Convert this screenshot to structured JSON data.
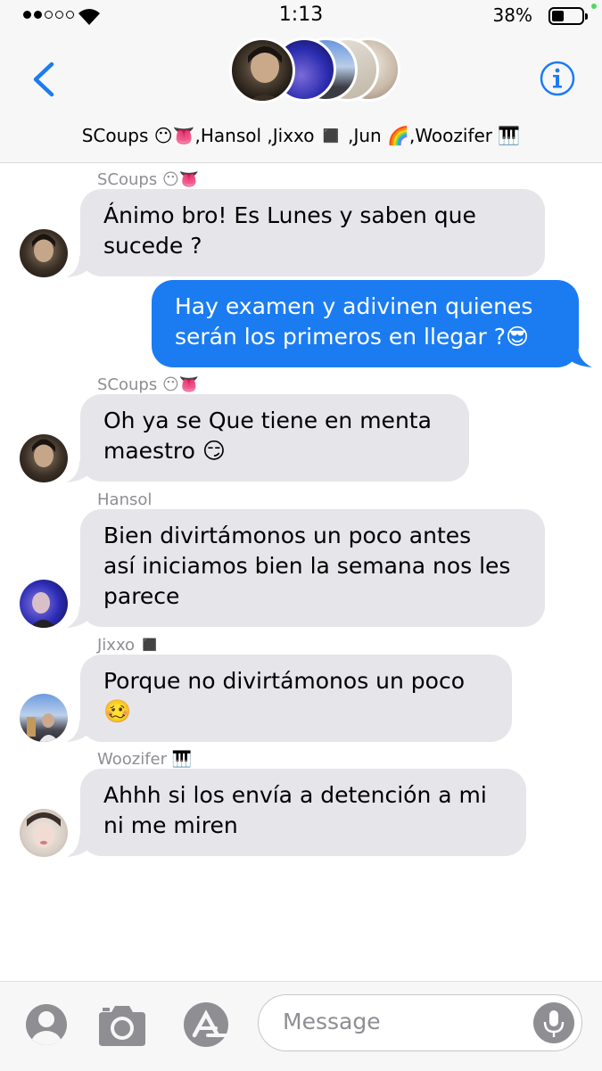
{
  "status_bar": {
    "time": "1:13",
    "battery_percent": "38%",
    "battery_level": 0.38,
    "signal_bars_filled": 2,
    "signal_bars_total": 5
  },
  "header": {
    "group_title": "SCoups 😶👅,Hansol ,Jixxo ◼️ ,Jun 🌈,Woozifer 🎹",
    "back_icon": "chevron-left-icon",
    "info_icon": "info-icon"
  },
  "messages": [
    {
      "sender": "SCoups 😶👅",
      "text": "Ánimo bro! Es Lunes y saben que sucede ?",
      "line1": "Ánimo bro! Es Lunes y saben que",
      "line2": "sucede ?",
      "direction": "incoming"
    },
    {
      "sender": "",
      "text": "Hay examen y adivinen quienes serán los primeros en llegar ?😎",
      "line1": "Hay examen y adivinen quienes",
      "line2": "serán los primeros en llegar ?😎",
      "direction": "outgoing"
    },
    {
      "sender": "SCoups 😶👅",
      "text": "Oh ya se Que tiene en menta maestro 😏",
      "line1": "Oh ya se Que tiene en menta",
      "line2": "maestro 😏",
      "direction": "incoming"
    },
    {
      "sender": "Hansol",
      "text": "Bien divirtámonos un poco antes así iniciamos bien la semana nos les parece",
      "line1": "Bien divirtámonos un poco antes",
      "line2": "así iniciamos bien la semana nos les",
      "line3": "parece",
      "direction": "incoming"
    },
    {
      "sender": "Jixxo ◼️",
      "text": "Porque no divirtámonos un poco 🥴",
      "line1": "Porque no divirtámonos un poco",
      "line2": "🥴",
      "direction": "incoming"
    },
    {
      "sender": "Woozifer 🎹",
      "text": "Ahhh si los envía a detención a mi ni me miren",
      "line1": "Ahhh si los envía a detención a mi",
      "line2": "ni me miren",
      "direction": "incoming"
    }
  ],
  "input_bar": {
    "placeholder": "Message",
    "icons": [
      "person-icon",
      "camera-icon",
      "app-store-icon",
      "microphone-icon"
    ]
  },
  "colors": {
    "accent": "#1b7cf2",
    "incoming_bubble": "#e5e5ea",
    "header_bg": "#f7f7f7",
    "secondary_text": "#8e8e93"
  }
}
